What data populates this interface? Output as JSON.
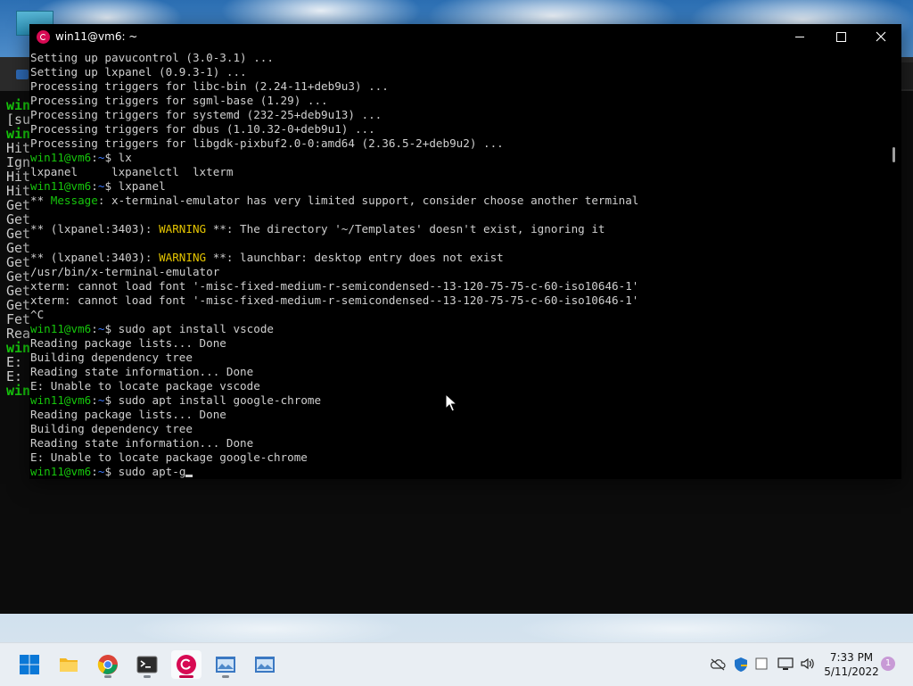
{
  "window": {
    "title": "win11@vm6: ~",
    "scroll_position": 0.25
  },
  "terminal": {
    "lines": [
      {
        "kind": "out",
        "text": "Setting up pavucontrol (3.0-3.1) ..."
      },
      {
        "kind": "out",
        "text": "Setting up lxpanel (0.9.3-1) ..."
      },
      {
        "kind": "out",
        "text": "Processing triggers for libc-bin (2.24-11+deb9u3) ..."
      },
      {
        "kind": "out",
        "text": "Processing triggers for sgml-base (1.29) ..."
      },
      {
        "kind": "out",
        "text": "Processing triggers for systemd (232-25+deb9u13) ..."
      },
      {
        "kind": "out",
        "text": "Processing triggers for dbus (1.10.32-0+deb9u1) ..."
      },
      {
        "kind": "out",
        "text": "Processing triggers for libgdk-pixbuf2.0-0:amd64 (2.36.5-2+deb9u2) ..."
      },
      {
        "kind": "prompt",
        "user": "win11@vm6",
        "sep": ":",
        "path": "~",
        "sym": "$ ",
        "cmd": "lx"
      },
      {
        "kind": "out",
        "text": "lxpanel     lxpanelctl  lxterm"
      },
      {
        "kind": "prompt",
        "user": "win11@vm6",
        "sep": ":",
        "path": "~",
        "sym": "$ ",
        "cmd": "lxpanel"
      },
      {
        "kind": "msg",
        "pre": "** ",
        "label": "Message",
        "post": ": x-terminal-emulator has very limited support, consider choose another terminal"
      },
      {
        "kind": "out",
        "text": ""
      },
      {
        "kind": "warn",
        "pre": "** (lxpanel:3403): ",
        "label": "WARNING",
        "post": " **: The directory '~/Templates' doesn't exist, ignoring it"
      },
      {
        "kind": "out",
        "text": ""
      },
      {
        "kind": "warn",
        "pre": "** (lxpanel:3403): ",
        "label": "WARNING",
        "post": " **: launchbar: desktop entry does not exist"
      },
      {
        "kind": "out",
        "text": "/usr/bin/x-terminal-emulator"
      },
      {
        "kind": "out",
        "text": "xterm: cannot load font '-misc-fixed-medium-r-semicondensed--13-120-75-75-c-60-iso10646-1'"
      },
      {
        "kind": "out",
        "text": "xterm: cannot load font '-misc-fixed-medium-r-semicondensed--13-120-75-75-c-60-iso10646-1'"
      },
      {
        "kind": "out",
        "text": "^C"
      },
      {
        "kind": "prompt",
        "user": "win11@vm6",
        "sep": ":",
        "path": "~",
        "sym": "$ ",
        "cmd": "sudo apt install vscode"
      },
      {
        "kind": "out",
        "text": "Reading package lists... Done"
      },
      {
        "kind": "out",
        "text": "Building dependency tree"
      },
      {
        "kind": "out",
        "text": "Reading state information... Done"
      },
      {
        "kind": "out",
        "text": "E: Unable to locate package vscode"
      },
      {
        "kind": "prompt",
        "user": "win11@vm6",
        "sep": ":",
        "path": "~",
        "sym": "$ ",
        "cmd": "sudo apt install google-chrome"
      },
      {
        "kind": "out",
        "text": "Reading package lists... Done"
      },
      {
        "kind": "out",
        "text": "Building dependency tree"
      },
      {
        "kind": "out",
        "text": "Reading state information... Done"
      },
      {
        "kind": "out",
        "text": "E: Unable to locate package google-chrome"
      },
      {
        "kind": "prompt",
        "user": "win11@vm6",
        "sep": ":",
        "path": "~",
        "sym": "$ ",
        "cmd": "sudo apt-g",
        "cursor": true
      }
    ]
  },
  "background_terminal": {
    "lines": [
      {
        "text": "win",
        "green": true
      },
      {
        "text": "[su",
        "green": false
      },
      {
        "text": "win",
        "green": true
      },
      {
        "text": "Hit",
        "green": false
      },
      {
        "text": "Ign",
        "green": false
      },
      {
        "text": "Hit",
        "green": false
      },
      {
        "text": "Hit",
        "green": false
      },
      {
        "text": "Get",
        "green": false
      },
      {
        "text": "Get",
        "green": false
      },
      {
        "text": "Get",
        "green": false
      },
      {
        "text": "Get",
        "green": false
      },
      {
        "text": "Get",
        "green": false
      },
      {
        "text": "Get",
        "green": false
      },
      {
        "text": "Get",
        "green": false
      },
      {
        "text": "Get",
        "green": false
      },
      {
        "text": "Fet",
        "green": false
      },
      {
        "text": "Rea",
        "green": false
      },
      {
        "text": "win",
        "green": true
      },
      {
        "text": "E: ",
        "green": false
      },
      {
        "text": "E: ",
        "green": false
      },
      {
        "text": "win",
        "green": true
      }
    ]
  },
  "taskbar": {
    "items": [
      {
        "name": "start-button",
        "icon": "windows-logo-icon",
        "active": false,
        "running": false
      },
      {
        "name": "file-explorer-button",
        "icon": "folder-icon",
        "active": false,
        "running": false
      },
      {
        "name": "chrome-button",
        "icon": "chrome-icon",
        "active": false,
        "running": true
      },
      {
        "name": "terminal-button",
        "icon": "terminal-icon",
        "active": false,
        "running": true
      },
      {
        "name": "debian-button",
        "icon": "debian-icon",
        "active": true,
        "running": true
      },
      {
        "name": "app-window-1-button",
        "icon": "image-window-icon",
        "active": false,
        "running": true
      },
      {
        "name": "app-window-2-button",
        "icon": "image-window-icon",
        "active": false,
        "running": false
      }
    ],
    "clock_time": "7:33 PM",
    "clock_date": "5/11/2022",
    "notification_count": "1"
  },
  "colors": {
    "prompt_user": "#16c60c",
    "prompt_path": "#3b78ff",
    "warning": "#e5c500",
    "debian_red": "#d70a53"
  }
}
